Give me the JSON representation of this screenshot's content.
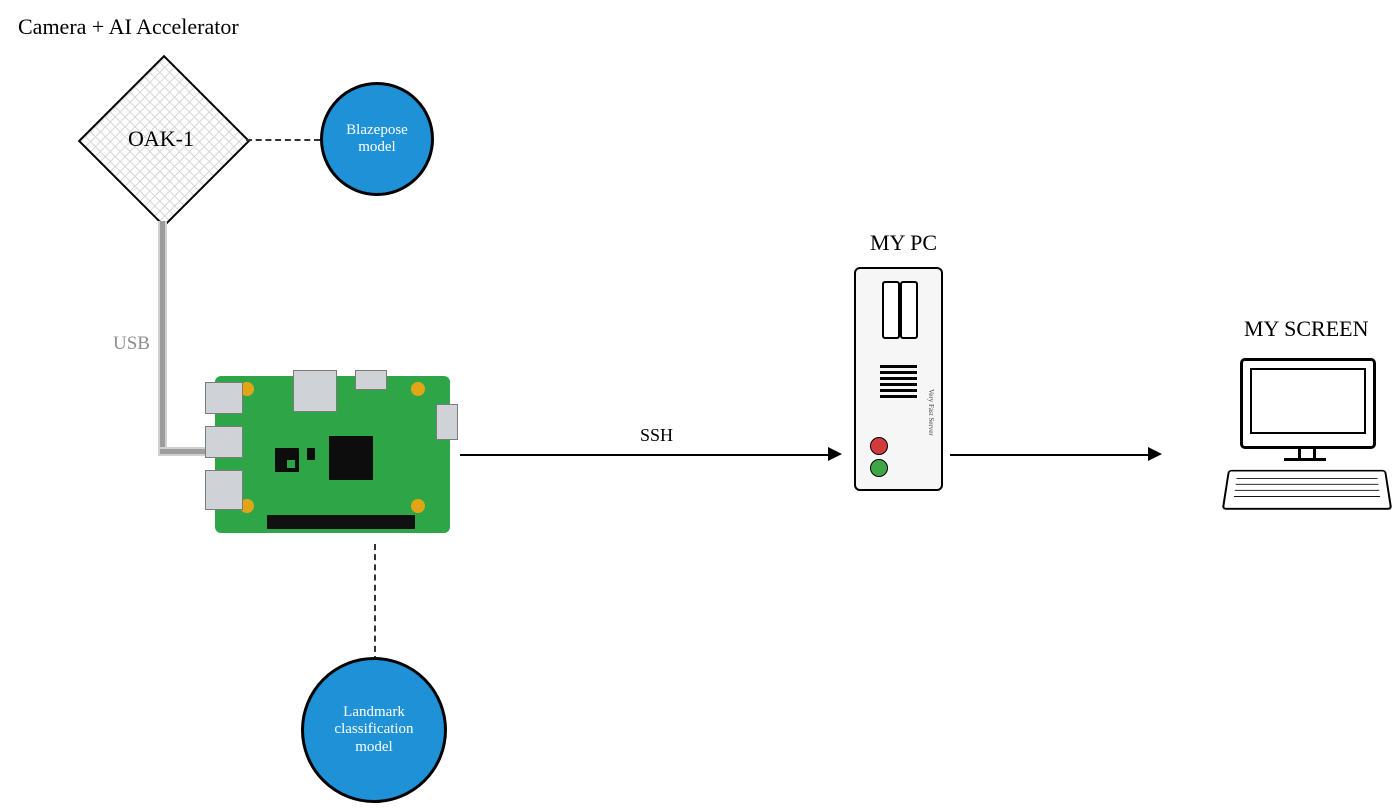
{
  "title": "Camera + AI Accelerator",
  "oak_label": "OAK-1",
  "blazepose": {
    "line1": "Blazepose",
    "line2": "model"
  },
  "usb_label": "USB",
  "ssh_label": "SSH",
  "pc_label": "MY PC",
  "pc_side": "Very Fast Server",
  "screen_label": "MY SCREEN",
  "landmark": {
    "line1": "Landmark",
    "line2": "classification",
    "line3": "model"
  }
}
